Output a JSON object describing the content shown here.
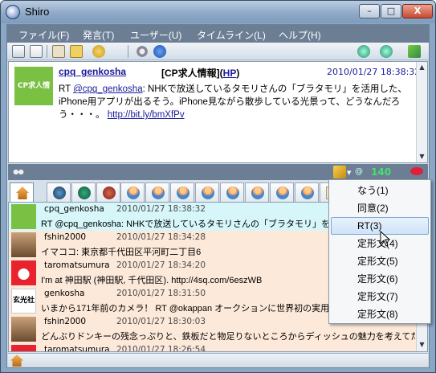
{
  "window": {
    "title": "Shiro",
    "controls": {
      "minimize": "–",
      "maximize": "□",
      "close": "X"
    }
  },
  "menu": [
    "ファイル(F)",
    "発言(T)",
    "ユーザー(U)",
    "タイムライン(L)",
    "ヘルプ(H)"
  ],
  "detail": {
    "avatar_text": "CP求人情報",
    "user": "cpq_genkosha",
    "display_name": "[CP求人情報]",
    "hp_open": "(",
    "hp_label": "HP",
    "hp_close": ")",
    "date": "2010/01/27 18:38:32",
    "text_prefix": "RT ",
    "mention": "@cpq_genkosha",
    "text_body": ": NHKで放送しているタモリさんの「ブラタモリ」を活用した、iPhone用アプリが出るそう。iPhone見ながら散歩している光景って、どうなんだろう・・・。 ",
    "link": "http://bit.ly/bmXfPv"
  },
  "status": {
    "count": "140"
  },
  "timeline": [
    {
      "name": "cpq_genkosha",
      "date": "2010/01/27 18:38:32",
      "text": "RT @cpq_genkosha: NHKで放送しているタモリさんの「ブラタモリ」を活用した、iPhone",
      "bg": "#d6f6fa"
    },
    {
      "name": "fshin2000",
      "date": "2010/01/27 18:34:28",
      "text": "イマココ: 東京都千代田区平河町二丁目6",
      "bg": "#fde9d9"
    },
    {
      "name": "taromatsumura",
      "date": "2010/01/27 18:34:20",
      "text": "I'm at 神田駅 (神田駅, 千代田区). http://4sq.com/6eszWB",
      "bg": "#fde9d9"
    },
    {
      "name": "genkosha",
      "date": "2010/01/27 18:31:50",
      "text": "いまから171年前のカメラ！ RT @okappan オークションに世界初の実用カメラ",
      "bg": "#fde9d9"
    },
    {
      "name": "fshin2000",
      "date": "2010/01/27 18:30:03",
      "text": "どんぶりドンキーの残念っぷりと、鉄板だと物足りないところからディッシュの魅力を考えてたら、これ",
      "bg": "#fde9d9"
    },
    {
      "name": "taromatsumura",
      "date": "2010/01/27 18:26:54",
      "text": "",
      "bg": "#fde9d9"
    }
  ],
  "context_menu": {
    "items": [
      "なう(1)",
      "同意(2)",
      "RT(3)",
      "定形文(4)",
      "定形文(5)",
      "定形文(6)",
      "定形文(7)",
      "定形文(8)"
    ],
    "highlighted": "RT(3)"
  },
  "colors": {
    "menubar": "#6b7e94",
    "row_selected": "#d6f6fa",
    "row_normal": "#fde9d9",
    "link": "#1a1a9a",
    "counter": "#48e070"
  }
}
